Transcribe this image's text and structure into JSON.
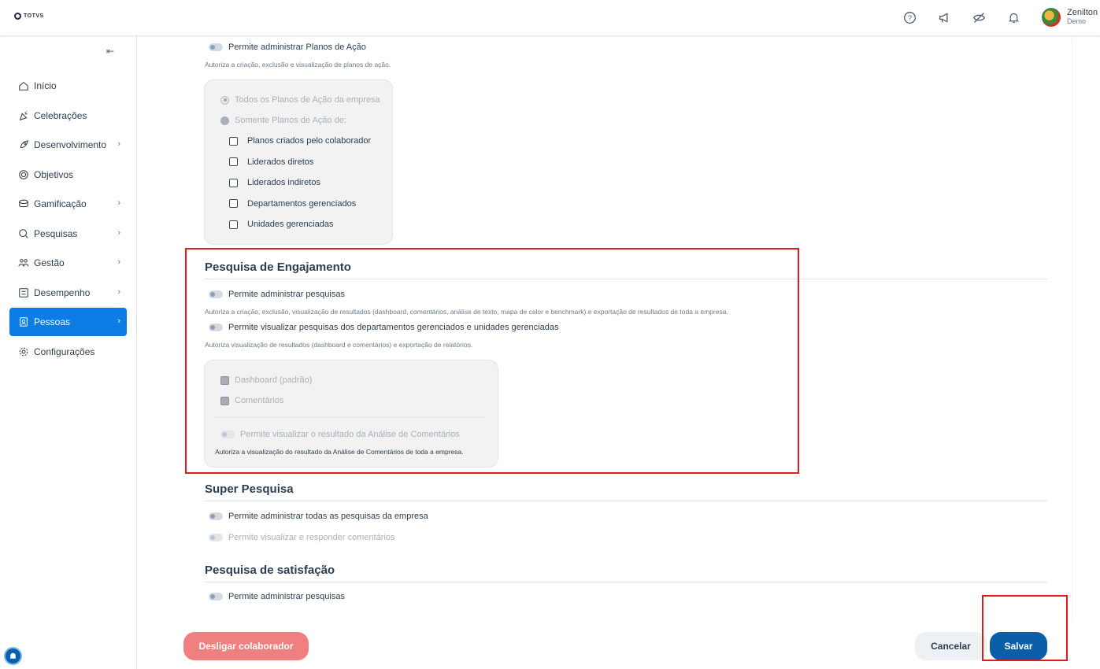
{
  "app": {
    "logo_text": "TOTVS"
  },
  "user": {
    "name": "Zenilton",
    "sub": "Demo"
  },
  "sidebar": {
    "items": [
      {
        "label": "Início",
        "icon": "home-icon",
        "chevron": false
      },
      {
        "label": "Celebrações",
        "icon": "party-icon",
        "chevron": false
      },
      {
        "label": "Desenvolvimento",
        "icon": "rocket-icon",
        "chevron": true
      },
      {
        "label": "Objetivos",
        "icon": "target-icon",
        "chevron": false
      },
      {
        "label": "Gamificação",
        "icon": "coins-icon",
        "chevron": true
      },
      {
        "label": "Pesquisas",
        "icon": "search-survey-icon",
        "chevron": true
      },
      {
        "label": "Gestão",
        "icon": "people-icon",
        "chevron": true
      },
      {
        "label": "Desempenho",
        "icon": "checklist-icon",
        "chevron": true
      },
      {
        "label": "Pessoas",
        "icon": "badge-icon",
        "chevron": true,
        "active": true
      },
      {
        "label": "Configurações",
        "icon": "gear-icon",
        "chevron": false
      }
    ]
  },
  "action_plans": {
    "toggle_label": "Permite administrar Planos de Ação",
    "description": "Autoriza a criação, exclusão e visualização de planos de ação.",
    "radio_all": "Todos os Planos de Ação da empresa",
    "radio_only": "Somente Planos de Ação de:",
    "checks": [
      "Planos criados pelo colaborador",
      "Liderados diretos",
      "Liderados indiretos",
      "Departamentos gerenciados",
      "Unidades gerenciadas"
    ]
  },
  "engagement": {
    "title": "Pesquisa de Engajamento",
    "admin_label": "Permite administrar pesquisas",
    "admin_desc": "Autoriza a criação, exclusão, visualização de resultados (dashboard, comentários, análise de texto, mapa de calor e benchmark) e exportação de resultados de toda a empresa.",
    "view_label": "Permite visualizar pesquisas dos departamentos gerenciados e unidades gerenciadas",
    "view_desc": "Autoriza visualização de resultados (dashboard e comentários) e exportação de relatórios.",
    "check_dashboard": "Dashboard (padrão)",
    "check_comments": "Comentários",
    "analysis_label": "Permite visualizar o resultado da Análise de Comentários",
    "analysis_desc": "Autoriza a visualização do resultado da Análise de Comentários de toda a empresa."
  },
  "super": {
    "title": "Super Pesquisa",
    "admin_all": "Permite administrar todas as pesquisas da empresa",
    "view_comments": "Permite visualizar e responder comentários"
  },
  "satisfaction": {
    "title": "Pesquisa de satisfação",
    "admin_label": "Permite administrar pesquisas"
  },
  "footer": {
    "dismiss": "Desligar colaborador",
    "cancel": "Cancelar",
    "save": "Salvar"
  },
  "colors": {
    "primary": "#0b5ea8",
    "active_nav": "#0c7ce6",
    "danger": "#f08080",
    "highlight": "#e31b1b"
  }
}
